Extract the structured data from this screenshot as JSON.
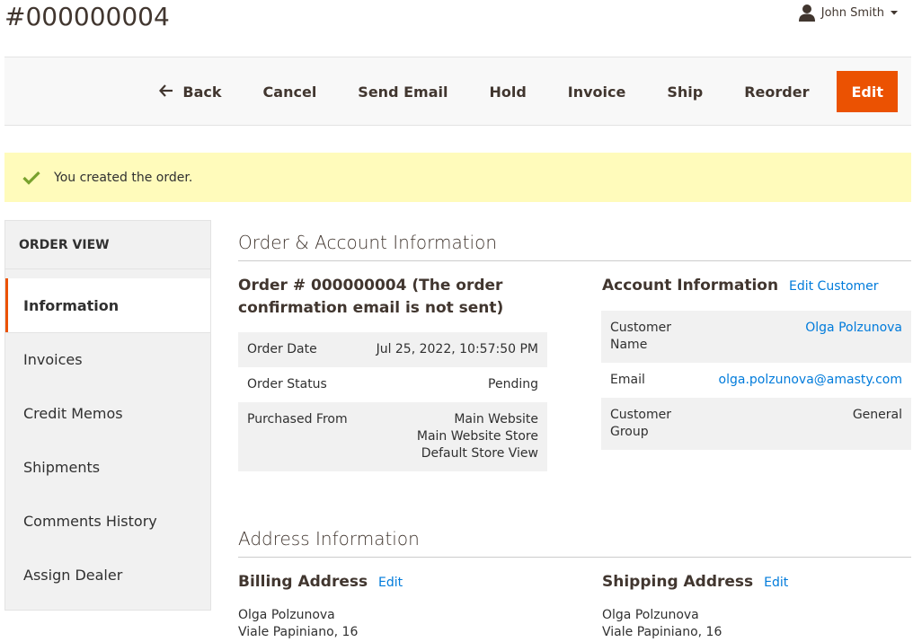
{
  "page": {
    "title": "#000000004"
  },
  "user": {
    "name": "John Smith"
  },
  "actions": {
    "back": "Back",
    "cancel": "Cancel",
    "send_email": "Send Email",
    "hold": "Hold",
    "invoice": "Invoice",
    "ship": "Ship",
    "reorder": "Reorder",
    "edit": "Edit"
  },
  "message": {
    "text": "You created the order."
  },
  "sidebar": {
    "title": "ORDER VIEW",
    "items": [
      {
        "label": "Information"
      },
      {
        "label": "Invoices"
      },
      {
        "label": "Credit Memos"
      },
      {
        "label": "Shipments"
      },
      {
        "label": "Comments History"
      },
      {
        "label": "Assign Dealer"
      }
    ]
  },
  "order_section": {
    "title": "Order & Account Information",
    "order_heading_line1": "Order # 000000004 (The order",
    "order_heading_line2": "confirmation email is not sent)",
    "rows": [
      {
        "label": "Order Date",
        "value": "Jul 25, 2022, 10:57:50 PM"
      },
      {
        "label": "Order Status",
        "value": "Pending"
      },
      {
        "label": "Purchased From",
        "value_lines": [
          "Main Website",
          "Main Website Store",
          "Default Store View"
        ]
      }
    ]
  },
  "account": {
    "title": "Account Information",
    "edit_label": "Edit Customer",
    "rows": [
      {
        "label": "Customer Name",
        "value": "Olga Polzunova"
      },
      {
        "label": "Email",
        "value": "olga.polzunova@amasty.com"
      },
      {
        "label": "Customer Group",
        "value": "General"
      }
    ]
  },
  "address_section": {
    "title": "Address Information",
    "billing": {
      "title": "Billing Address",
      "edit_label": "Edit",
      "lines": [
        "Olga Polzunova",
        "Viale Papiniano, 16"
      ]
    },
    "shipping": {
      "title": "Shipping Address",
      "edit_label": "Edit",
      "lines": [
        "Olga Polzunova",
        "Viale Papiniano, 16"
      ]
    }
  },
  "colors": {
    "accent": "#eb5202",
    "link": "#007bdb",
    "success_bg": "#fffbbb",
    "success_check": "#79a22e"
  }
}
